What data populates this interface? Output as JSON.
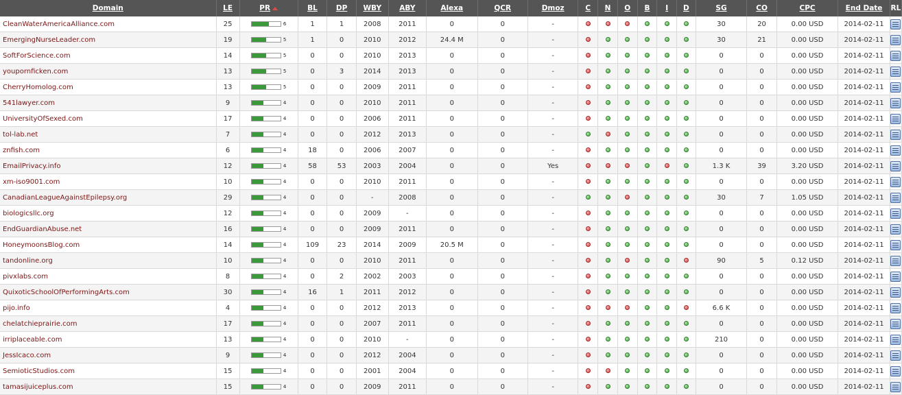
{
  "header": {
    "domain": "Domain",
    "le": "LE",
    "pr": "PR",
    "bl": "BL",
    "dp": "DP",
    "wby": "WBY",
    "aby": "ABY",
    "alexa": "Alexa",
    "qcr": "QCR",
    "dmoz": "Dmoz",
    "c": "C",
    "n": "N",
    "o": "O",
    "b": "B",
    "i": "I",
    "d": "D",
    "sg": "SG",
    "co": "CO",
    "cpc": "CPC",
    "end_date": "End Date",
    "rl": "RL"
  },
  "colors": {
    "green": "#3e9e3a",
    "red": "#d04040",
    "header_bg": "#555555",
    "domain_text": "#7a1515"
  },
  "rows": [
    {
      "domain": "CleanWaterAmericaAlliance.com",
      "le": "25",
      "pr": "6",
      "bl": "1",
      "dp": "1",
      "wby": "2008",
      "aby": "2011",
      "alexa": "0",
      "qcr": "0",
      "dmoz": "-",
      "c": "r",
      "n": "r",
      "o": "r",
      "b": "g",
      "i": "g",
      "d": "g",
      "sg": "30",
      "co": "20",
      "cpc": "0.00 USD",
      "end": "2014-02-11"
    },
    {
      "domain": "EmergingNurseLeader.com",
      "le": "19",
      "pr": "5",
      "bl": "1",
      "dp": "0",
      "wby": "2010",
      "aby": "2012",
      "alexa": "24.4 M",
      "qcr": "0",
      "dmoz": "-",
      "c": "r",
      "n": "g",
      "o": "g",
      "b": "g",
      "i": "g",
      "d": "g",
      "sg": "30",
      "co": "21",
      "cpc": "0.00 USD",
      "end": "2014-02-11"
    },
    {
      "domain": "SoftForScience.com",
      "le": "14",
      "pr": "5",
      "bl": "0",
      "dp": "0",
      "wby": "2010",
      "aby": "2013",
      "alexa": "0",
      "qcr": "0",
      "dmoz": "-",
      "c": "r",
      "n": "g",
      "o": "g",
      "b": "g",
      "i": "g",
      "d": "g",
      "sg": "0",
      "co": "0",
      "cpc": "0.00 USD",
      "end": "2014-02-11"
    },
    {
      "domain": "youpornficken.com",
      "le": "13",
      "pr": "5",
      "bl": "0",
      "dp": "3",
      "wby": "2014",
      "aby": "2013",
      "alexa": "0",
      "qcr": "0",
      "dmoz": "-",
      "c": "r",
      "n": "g",
      "o": "g",
      "b": "g",
      "i": "g",
      "d": "g",
      "sg": "0",
      "co": "0",
      "cpc": "0.00 USD",
      "end": "2014-02-11"
    },
    {
      "domain": "CherryHomolog.com",
      "le": "13",
      "pr": "5",
      "bl": "0",
      "dp": "0",
      "wby": "2009",
      "aby": "2011",
      "alexa": "0",
      "qcr": "0",
      "dmoz": "-",
      "c": "r",
      "n": "g",
      "o": "g",
      "b": "g",
      "i": "g",
      "d": "g",
      "sg": "0",
      "co": "0",
      "cpc": "0.00 USD",
      "end": "2014-02-11"
    },
    {
      "domain": "541lawyer.com",
      "le": "9",
      "pr": "4",
      "bl": "0",
      "dp": "0",
      "wby": "2010",
      "aby": "2011",
      "alexa": "0",
      "qcr": "0",
      "dmoz": "-",
      "c": "r",
      "n": "g",
      "o": "g",
      "b": "g",
      "i": "g",
      "d": "g",
      "sg": "0",
      "co": "0",
      "cpc": "0.00 USD",
      "end": "2014-02-11"
    },
    {
      "domain": "UniversityOfSexed.com",
      "le": "17",
      "pr": "4",
      "bl": "0",
      "dp": "0",
      "wby": "2006",
      "aby": "2011",
      "alexa": "0",
      "qcr": "0",
      "dmoz": "-",
      "c": "r",
      "n": "g",
      "o": "g",
      "b": "g",
      "i": "g",
      "d": "g",
      "sg": "0",
      "co": "0",
      "cpc": "0.00 USD",
      "end": "2014-02-11"
    },
    {
      "domain": "tol-lab.net",
      "le": "7",
      "pr": "4",
      "bl": "0",
      "dp": "0",
      "wby": "2012",
      "aby": "2013",
      "alexa": "0",
      "qcr": "0",
      "dmoz": "-",
      "c": "g",
      "n": "r",
      "o": "g",
      "b": "g",
      "i": "g",
      "d": "g",
      "sg": "0",
      "co": "0",
      "cpc": "0.00 USD",
      "end": "2014-02-11"
    },
    {
      "domain": "znfish.com",
      "le": "6",
      "pr": "4",
      "bl": "18",
      "dp": "0",
      "wby": "2006",
      "aby": "2007",
      "alexa": "0",
      "qcr": "0",
      "dmoz": "-",
      "c": "r",
      "n": "g",
      "o": "g",
      "b": "g",
      "i": "g",
      "d": "g",
      "sg": "0",
      "co": "0",
      "cpc": "0.00 USD",
      "end": "2014-02-11"
    },
    {
      "domain": "EmailPrivacy.info",
      "le": "12",
      "pr": "4",
      "bl": "58",
      "dp": "53",
      "wby": "2003",
      "aby": "2004",
      "alexa": "0",
      "qcr": "0",
      "dmoz": "Yes",
      "c": "r",
      "n": "r",
      "o": "r",
      "b": "g",
      "i": "r",
      "d": "g",
      "sg": "1.3 K",
      "co": "39",
      "cpc": "3.20 USD",
      "end": "2014-02-11"
    },
    {
      "domain": "xm-iso9001.com",
      "le": "10",
      "pr": "4",
      "bl": "0",
      "dp": "0",
      "wby": "2010",
      "aby": "2011",
      "alexa": "0",
      "qcr": "0",
      "dmoz": "-",
      "c": "r",
      "n": "g",
      "o": "g",
      "b": "g",
      "i": "g",
      "d": "g",
      "sg": "0",
      "co": "0",
      "cpc": "0.00 USD",
      "end": "2014-02-11"
    },
    {
      "domain": "CanadianLeagueAgainstEpilepsy.org",
      "le": "29",
      "pr": "4",
      "bl": "0",
      "dp": "0",
      "wby": "-",
      "aby": "2008",
      "alexa": "0",
      "qcr": "0",
      "dmoz": "-",
      "c": "g",
      "n": "g",
      "o": "r",
      "b": "g",
      "i": "g",
      "d": "g",
      "sg": "30",
      "co": "7",
      "cpc": "1.05 USD",
      "end": "2014-02-11"
    },
    {
      "domain": "biologicsllc.org",
      "le": "12",
      "pr": "4",
      "bl": "0",
      "dp": "0",
      "wby": "2009",
      "aby": "-",
      "alexa": "0",
      "qcr": "0",
      "dmoz": "-",
      "c": "r",
      "n": "g",
      "o": "g",
      "b": "g",
      "i": "g",
      "d": "g",
      "sg": "0",
      "co": "0",
      "cpc": "0.00 USD",
      "end": "2014-02-11"
    },
    {
      "domain": "EndGuardianAbuse.net",
      "le": "16",
      "pr": "4",
      "bl": "0",
      "dp": "0",
      "wby": "2009",
      "aby": "2011",
      "alexa": "0",
      "qcr": "0",
      "dmoz": "-",
      "c": "r",
      "n": "g",
      "o": "g",
      "b": "g",
      "i": "g",
      "d": "g",
      "sg": "0",
      "co": "0",
      "cpc": "0.00 USD",
      "end": "2014-02-11"
    },
    {
      "domain": "HoneymoonsBlog.com",
      "le": "14",
      "pr": "4",
      "bl": "109",
      "dp": "23",
      "wby": "2014",
      "aby": "2009",
      "alexa": "20.5 M",
      "qcr": "0",
      "dmoz": "-",
      "c": "r",
      "n": "g",
      "o": "g",
      "b": "g",
      "i": "g",
      "d": "g",
      "sg": "0",
      "co": "0",
      "cpc": "0.00 USD",
      "end": "2014-02-11"
    },
    {
      "domain": "tandonline.org",
      "le": "10",
      "pr": "4",
      "bl": "0",
      "dp": "0",
      "wby": "2010",
      "aby": "2011",
      "alexa": "0",
      "qcr": "0",
      "dmoz": "-",
      "c": "r",
      "n": "g",
      "o": "r",
      "b": "g",
      "i": "g",
      "d": "r",
      "sg": "90",
      "co": "5",
      "cpc": "0.12 USD",
      "end": "2014-02-11"
    },
    {
      "domain": "pivxlabs.com",
      "le": "8",
      "pr": "4",
      "bl": "0",
      "dp": "2",
      "wby": "2002",
      "aby": "2003",
      "alexa": "0",
      "qcr": "0",
      "dmoz": "-",
      "c": "r",
      "n": "g",
      "o": "g",
      "b": "g",
      "i": "g",
      "d": "g",
      "sg": "0",
      "co": "0",
      "cpc": "0.00 USD",
      "end": "2014-02-11"
    },
    {
      "domain": "QuixoticSchoolOfPerformingArts.com",
      "le": "30",
      "pr": "4",
      "bl": "16",
      "dp": "1",
      "wby": "2011",
      "aby": "2012",
      "alexa": "0",
      "qcr": "0",
      "dmoz": "-",
      "c": "r",
      "n": "g",
      "o": "g",
      "b": "g",
      "i": "g",
      "d": "g",
      "sg": "0",
      "co": "0",
      "cpc": "0.00 USD",
      "end": "2014-02-11"
    },
    {
      "domain": "pijo.info",
      "le": "4",
      "pr": "4",
      "bl": "0",
      "dp": "0",
      "wby": "2012",
      "aby": "2013",
      "alexa": "0",
      "qcr": "0",
      "dmoz": "-",
      "c": "r",
      "n": "r",
      "o": "r",
      "b": "g",
      "i": "g",
      "d": "r",
      "sg": "6.6 K",
      "co": "0",
      "cpc": "0.00 USD",
      "end": "2014-02-11"
    },
    {
      "domain": "chelatchieprairie.com",
      "le": "17",
      "pr": "4",
      "bl": "0",
      "dp": "0",
      "wby": "2007",
      "aby": "2011",
      "alexa": "0",
      "qcr": "0",
      "dmoz": "-",
      "c": "r",
      "n": "g",
      "o": "g",
      "b": "g",
      "i": "g",
      "d": "g",
      "sg": "0",
      "co": "0",
      "cpc": "0.00 USD",
      "end": "2014-02-11"
    },
    {
      "domain": "irriplaceable.com",
      "le": "13",
      "pr": "4",
      "bl": "0",
      "dp": "0",
      "wby": "2010",
      "aby": "-",
      "alexa": "0",
      "qcr": "0",
      "dmoz": "-",
      "c": "r",
      "n": "g",
      "o": "g",
      "b": "g",
      "i": "g",
      "d": "g",
      "sg": "210",
      "co": "0",
      "cpc": "0.00 USD",
      "end": "2014-02-11"
    },
    {
      "domain": "JessIcaco.com",
      "le": "9",
      "pr": "4",
      "bl": "0",
      "dp": "0",
      "wby": "2012",
      "aby": "2004",
      "alexa": "0",
      "qcr": "0",
      "dmoz": "-",
      "c": "r",
      "n": "g",
      "o": "g",
      "b": "g",
      "i": "g",
      "d": "g",
      "sg": "0",
      "co": "0",
      "cpc": "0.00 USD",
      "end": "2014-02-11"
    },
    {
      "domain": "SemioticStudios.com",
      "le": "15",
      "pr": "4",
      "bl": "0",
      "dp": "0",
      "wby": "2001",
      "aby": "2004",
      "alexa": "0",
      "qcr": "0",
      "dmoz": "-",
      "c": "r",
      "n": "r",
      "o": "g",
      "b": "g",
      "i": "g",
      "d": "g",
      "sg": "0",
      "co": "0",
      "cpc": "0.00 USD",
      "end": "2014-02-11"
    },
    {
      "domain": "tamasijuiceplus.com",
      "le": "15",
      "pr": "4",
      "bl": "0",
      "dp": "0",
      "wby": "2009",
      "aby": "2011",
      "alexa": "0",
      "qcr": "0",
      "dmoz": "-",
      "c": "r",
      "n": "g",
      "o": "g",
      "b": "g",
      "i": "g",
      "d": "g",
      "sg": "0",
      "co": "0",
      "cpc": "0.00 USD",
      "end": "2014-02-11"
    }
  ]
}
